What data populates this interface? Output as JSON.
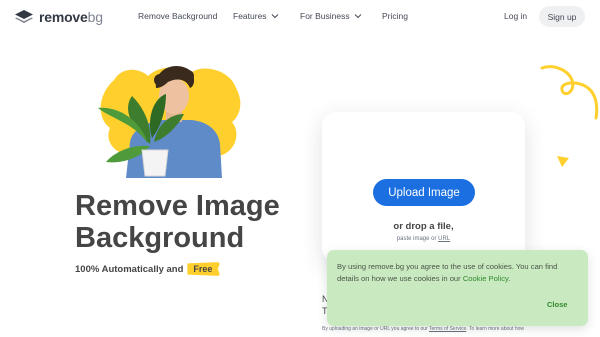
{
  "header": {
    "logo": {
      "main": "remove",
      "suffix": "bg"
    },
    "nav": [
      {
        "label": "Remove Background",
        "has_chevron": false
      },
      {
        "label": "Features",
        "has_chevron": true
      },
      {
        "label": "For Business",
        "has_chevron": true
      },
      {
        "label": "Pricing",
        "has_chevron": false
      }
    ],
    "login_label": "Log in",
    "signup_label": "Sign up"
  },
  "hero": {
    "title_line1": "Remove Image",
    "title_line2": "Background",
    "subtitle": "100% Automatically and",
    "badge": "Free"
  },
  "upload": {
    "button_label": "Upload Image",
    "drop_text": "or drop a file,",
    "paste_prefix": "paste image or",
    "paste_url": "URL"
  },
  "below_card": {
    "frag1": "N",
    "frag2": "T",
    "fine_print": "By uploading an image or URL you agree to our",
    "terms_link": "Terms of Service",
    "fine_print_tail": ". To learn more about how"
  },
  "cookie": {
    "text": "By using remove.bg you agree to the use of cookies. You can find details on how we use cookies in our",
    "policy_link": "Cookie Policy",
    "policy_tail": ".",
    "close_label": "Close"
  },
  "colors": {
    "primary": "#1b6fe0",
    "accent_yellow": "#ffd02d",
    "cookie_bg": "#c9e9c0",
    "cookie_link": "#2f8a2c",
    "text_dark": "#454545"
  },
  "icons": [
    "logo-layers-icon",
    "chevron-down-icon",
    "squiggle-decoration",
    "triangle-decoration"
  ]
}
